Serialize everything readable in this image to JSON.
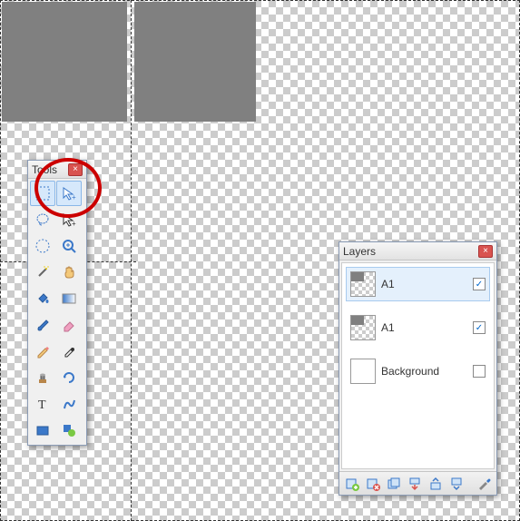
{
  "tools_panel": {
    "title": "Tools"
  },
  "layers_panel": {
    "title": "Layers",
    "layers": [
      {
        "name": "A1",
        "visible": true,
        "selected": true
      },
      {
        "name": "A1",
        "visible": true,
        "selected": false
      },
      {
        "name": "Background",
        "visible": false,
        "selected": false
      }
    ]
  },
  "icons": {
    "close": "×",
    "check": "✓"
  }
}
